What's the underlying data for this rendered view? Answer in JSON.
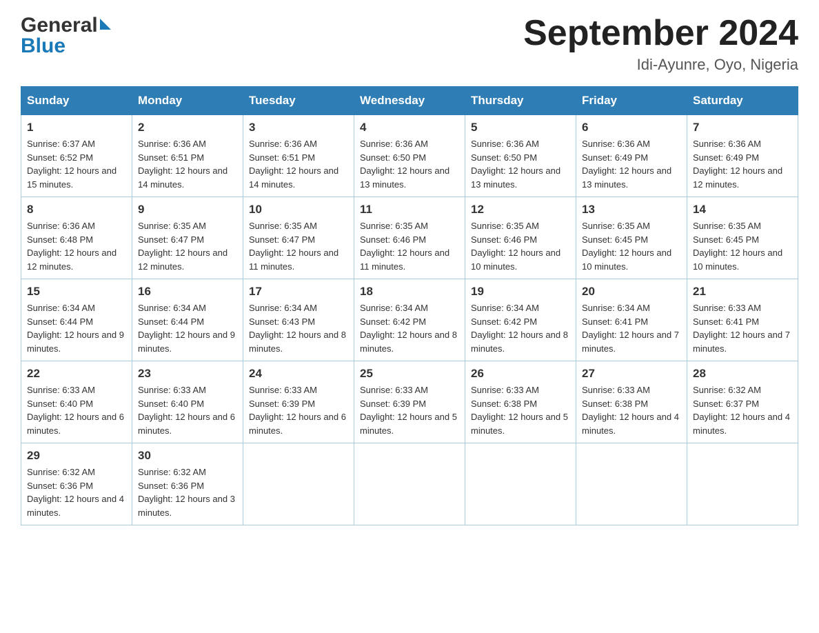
{
  "header": {
    "logo_general": "General",
    "logo_blue": "Blue",
    "month_title": "September 2024",
    "subtitle": "Idi-Ayunre, Oyo, Nigeria"
  },
  "calendar": {
    "days_of_week": [
      "Sunday",
      "Monday",
      "Tuesday",
      "Wednesday",
      "Thursday",
      "Friday",
      "Saturday"
    ],
    "weeks": [
      [
        {
          "day": "1",
          "sunrise": "Sunrise: 6:37 AM",
          "sunset": "Sunset: 6:52 PM",
          "daylight": "Daylight: 12 hours and 15 minutes."
        },
        {
          "day": "2",
          "sunrise": "Sunrise: 6:36 AM",
          "sunset": "Sunset: 6:51 PM",
          "daylight": "Daylight: 12 hours and 14 minutes."
        },
        {
          "day": "3",
          "sunrise": "Sunrise: 6:36 AM",
          "sunset": "Sunset: 6:51 PM",
          "daylight": "Daylight: 12 hours and 14 minutes."
        },
        {
          "day": "4",
          "sunrise": "Sunrise: 6:36 AM",
          "sunset": "Sunset: 6:50 PM",
          "daylight": "Daylight: 12 hours and 13 minutes."
        },
        {
          "day": "5",
          "sunrise": "Sunrise: 6:36 AM",
          "sunset": "Sunset: 6:50 PM",
          "daylight": "Daylight: 12 hours and 13 minutes."
        },
        {
          "day": "6",
          "sunrise": "Sunrise: 6:36 AM",
          "sunset": "Sunset: 6:49 PM",
          "daylight": "Daylight: 12 hours and 13 minutes."
        },
        {
          "day": "7",
          "sunrise": "Sunrise: 6:36 AM",
          "sunset": "Sunset: 6:49 PM",
          "daylight": "Daylight: 12 hours and 12 minutes."
        }
      ],
      [
        {
          "day": "8",
          "sunrise": "Sunrise: 6:36 AM",
          "sunset": "Sunset: 6:48 PM",
          "daylight": "Daylight: 12 hours and 12 minutes."
        },
        {
          "day": "9",
          "sunrise": "Sunrise: 6:35 AM",
          "sunset": "Sunset: 6:47 PM",
          "daylight": "Daylight: 12 hours and 12 minutes."
        },
        {
          "day": "10",
          "sunrise": "Sunrise: 6:35 AM",
          "sunset": "Sunset: 6:47 PM",
          "daylight": "Daylight: 12 hours and 11 minutes."
        },
        {
          "day": "11",
          "sunrise": "Sunrise: 6:35 AM",
          "sunset": "Sunset: 6:46 PM",
          "daylight": "Daylight: 12 hours and 11 minutes."
        },
        {
          "day": "12",
          "sunrise": "Sunrise: 6:35 AM",
          "sunset": "Sunset: 6:46 PM",
          "daylight": "Daylight: 12 hours and 10 minutes."
        },
        {
          "day": "13",
          "sunrise": "Sunrise: 6:35 AM",
          "sunset": "Sunset: 6:45 PM",
          "daylight": "Daylight: 12 hours and 10 minutes."
        },
        {
          "day": "14",
          "sunrise": "Sunrise: 6:35 AM",
          "sunset": "Sunset: 6:45 PM",
          "daylight": "Daylight: 12 hours and 10 minutes."
        }
      ],
      [
        {
          "day": "15",
          "sunrise": "Sunrise: 6:34 AM",
          "sunset": "Sunset: 6:44 PM",
          "daylight": "Daylight: 12 hours and 9 minutes."
        },
        {
          "day": "16",
          "sunrise": "Sunrise: 6:34 AM",
          "sunset": "Sunset: 6:44 PM",
          "daylight": "Daylight: 12 hours and 9 minutes."
        },
        {
          "day": "17",
          "sunrise": "Sunrise: 6:34 AM",
          "sunset": "Sunset: 6:43 PM",
          "daylight": "Daylight: 12 hours and 8 minutes."
        },
        {
          "day": "18",
          "sunrise": "Sunrise: 6:34 AM",
          "sunset": "Sunset: 6:42 PM",
          "daylight": "Daylight: 12 hours and 8 minutes."
        },
        {
          "day": "19",
          "sunrise": "Sunrise: 6:34 AM",
          "sunset": "Sunset: 6:42 PM",
          "daylight": "Daylight: 12 hours and 8 minutes."
        },
        {
          "day": "20",
          "sunrise": "Sunrise: 6:34 AM",
          "sunset": "Sunset: 6:41 PM",
          "daylight": "Daylight: 12 hours and 7 minutes."
        },
        {
          "day": "21",
          "sunrise": "Sunrise: 6:33 AM",
          "sunset": "Sunset: 6:41 PM",
          "daylight": "Daylight: 12 hours and 7 minutes."
        }
      ],
      [
        {
          "day": "22",
          "sunrise": "Sunrise: 6:33 AM",
          "sunset": "Sunset: 6:40 PM",
          "daylight": "Daylight: 12 hours and 6 minutes."
        },
        {
          "day": "23",
          "sunrise": "Sunrise: 6:33 AM",
          "sunset": "Sunset: 6:40 PM",
          "daylight": "Daylight: 12 hours and 6 minutes."
        },
        {
          "day": "24",
          "sunrise": "Sunrise: 6:33 AM",
          "sunset": "Sunset: 6:39 PM",
          "daylight": "Daylight: 12 hours and 6 minutes."
        },
        {
          "day": "25",
          "sunrise": "Sunrise: 6:33 AM",
          "sunset": "Sunset: 6:39 PM",
          "daylight": "Daylight: 12 hours and 5 minutes."
        },
        {
          "day": "26",
          "sunrise": "Sunrise: 6:33 AM",
          "sunset": "Sunset: 6:38 PM",
          "daylight": "Daylight: 12 hours and 5 minutes."
        },
        {
          "day": "27",
          "sunrise": "Sunrise: 6:33 AM",
          "sunset": "Sunset: 6:38 PM",
          "daylight": "Daylight: 12 hours and 4 minutes."
        },
        {
          "day": "28",
          "sunrise": "Sunrise: 6:32 AM",
          "sunset": "Sunset: 6:37 PM",
          "daylight": "Daylight: 12 hours and 4 minutes."
        }
      ],
      [
        {
          "day": "29",
          "sunrise": "Sunrise: 6:32 AM",
          "sunset": "Sunset: 6:36 PM",
          "daylight": "Daylight: 12 hours and 4 minutes."
        },
        {
          "day": "30",
          "sunrise": "Sunrise: 6:32 AM",
          "sunset": "Sunset: 6:36 PM",
          "daylight": "Daylight: 12 hours and 3 minutes."
        },
        {
          "day": "",
          "sunrise": "",
          "sunset": "",
          "daylight": ""
        },
        {
          "day": "",
          "sunrise": "",
          "sunset": "",
          "daylight": ""
        },
        {
          "day": "",
          "sunrise": "",
          "sunset": "",
          "daylight": ""
        },
        {
          "day": "",
          "sunrise": "",
          "sunset": "",
          "daylight": ""
        },
        {
          "day": "",
          "sunrise": "",
          "sunset": "",
          "daylight": ""
        }
      ]
    ]
  }
}
